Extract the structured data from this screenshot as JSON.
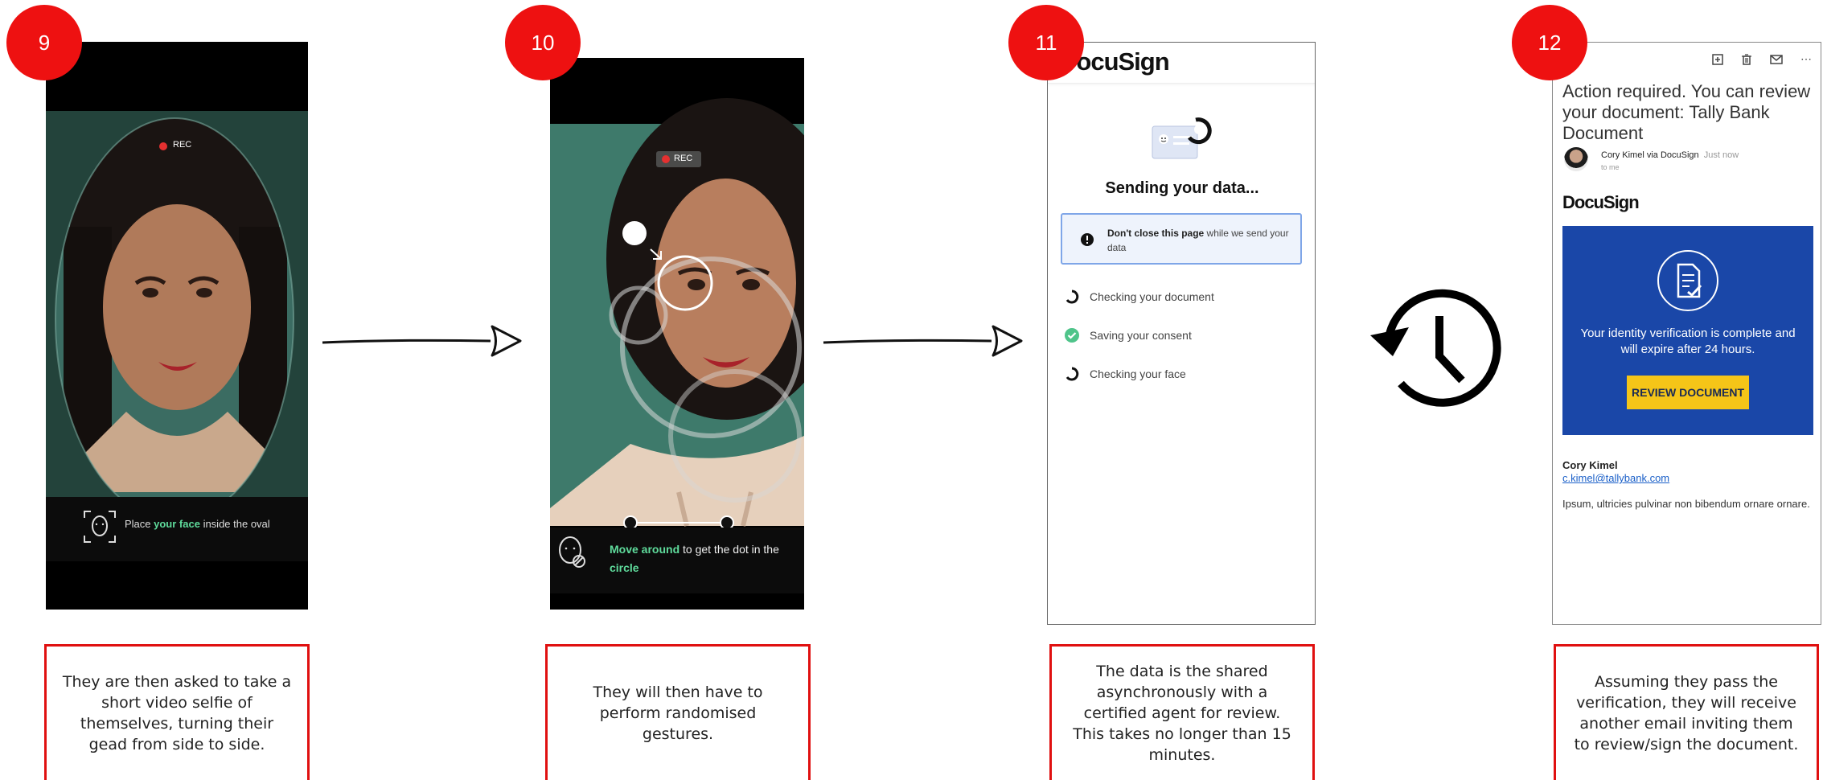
{
  "steps": [
    {
      "number": "9",
      "caption": "They are then asked to take a short video selfie of themselves, turning their gead from side to side.",
      "screen": {
        "rec_label": "REC",
        "instruction_pre": "Place ",
        "instruction_em": "your face",
        "instruction_post": " inside the oval"
      }
    },
    {
      "number": "10",
      "caption": "They will then have to perform randomised gestures.",
      "screen": {
        "rec_label": "REC",
        "instruction_em": "Move around",
        "instruction_post": " to get the dot in the",
        "instruction_em2": "circle"
      }
    },
    {
      "number": "11",
      "caption": "The data is the shared asynchronously with a certified agent for review.\nThis takes no longer than 15 minutes.",
      "screen": {
        "logo": "DocuSign",
        "heading": "Sending your data...",
        "notice_strong": "Don't close this page",
        "notice_rest": " while we send your data",
        "checks": [
          {
            "label": "Checking your document",
            "status": "loading"
          },
          {
            "label": "Saving your consent",
            "status": "done"
          },
          {
            "label": "Checking your face",
            "status": "loading"
          }
        ]
      }
    },
    {
      "number": "12",
      "caption": "Assuming they pass the verification, they will receive another email inviting them to review/sign the document.",
      "screen": {
        "subject": "Action required. You can review your document: Tally Bank Document",
        "sender": "Cory Kimel via DocuSign",
        "time": "Just now",
        "to": "to me",
        "logo": "DocuSign",
        "banner_text": "Your identity verification is complete and will expire after 24 hours.",
        "button_label": "REVIEW DOCUMENT",
        "signer_name": "Cory Kimel",
        "signer_email": "c.kimel@tallybank.com",
        "body": "Ipsum, ultricies pulvinar non bibendum ornare ornare."
      }
    }
  ],
  "colors": {
    "badge": "#ee1111",
    "caption_border": "#e01010",
    "accent_green": "#5fdc9c",
    "docusign_blue": "#1a47a8",
    "button_yellow": "#f5c518"
  },
  "icons": [
    "face-scan-icon",
    "face-gesture-icon",
    "arrow-right-icon",
    "history-clock-icon",
    "alert-icon",
    "spinner-icon",
    "check-circle-icon",
    "document-check-icon",
    "archive-icon",
    "trash-icon",
    "mail-icon",
    "more-icon"
  ]
}
